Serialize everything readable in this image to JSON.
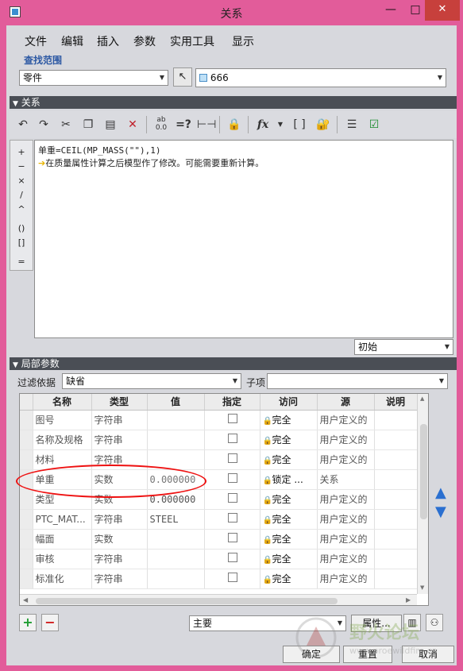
{
  "window": {
    "title": "关系",
    "minimize": "—",
    "maximize": "□",
    "close": "✕"
  },
  "menu": [
    "文件",
    "编辑",
    "插入",
    "参数",
    "实用工具",
    "显示"
  ],
  "scope": {
    "title": "查找范围",
    "type_value": "零件",
    "model_value": "666"
  },
  "relations": {
    "section_title": "关系",
    "operators": [
      "+",
      "−",
      "×",
      "/",
      "^",
      "()",
      "[]",
      "="
    ],
    "lines": [
      "单重=CEIL(MP_MASS(\"\"),1)",
      "在质量属性计算之后模型作了修改。可能需要重新计算。"
    ],
    "state_value": "初始"
  },
  "local_params": {
    "section_title": "局部参数",
    "filter_label": "过滤依据",
    "filter_value": "缺省",
    "subitem_label": "子项",
    "subitem_value": "",
    "columns": [
      "名称",
      "类型",
      "值",
      "指定",
      "访问",
      "源",
      "说明"
    ],
    "rows": [
      {
        "name": "图号",
        "type": "字符串",
        "value": "",
        "access": "完全",
        "source": "用户定义的"
      },
      {
        "name": "名称及规格",
        "type": "字符串",
        "value": "",
        "access": "完全",
        "source": "用户定义的"
      },
      {
        "name": "材料",
        "type": "字符串",
        "value": "",
        "access": "完全",
        "source": "用户定义的"
      },
      {
        "name": "单重",
        "type": "实数",
        "value": "0.000000",
        "access": "锁定 ...",
        "source": "关系"
      },
      {
        "name": "类型",
        "type": "实数",
        "value": "0.000000",
        "access": "完全",
        "source": "用户定义的"
      },
      {
        "name": "PTC_MAT...",
        "type": "字符串",
        "value": "STEEL",
        "access": "完全",
        "source": "用户定义的"
      },
      {
        "name": "幅面",
        "type": "实数",
        "value": "",
        "access": "完全",
        "source": "用户定义的"
      },
      {
        "name": "审核",
        "type": "字符串",
        "value": "",
        "access": "完全",
        "source": "用户定义的"
      },
      {
        "name": "标准化",
        "type": "字符串",
        "value": "",
        "access": "完全",
        "source": "用户定义的"
      }
    ]
  },
  "bottom": {
    "add": "+",
    "remove": "−",
    "main_value": "主要",
    "properties_label": "属性...",
    "ok_label": "确定",
    "reset_label": "重置",
    "cancel_label": "取消"
  },
  "watermark": {
    "text": "野火论坛",
    "url": "www.proewildfire.cn"
  },
  "colors": {
    "titlebar": "#e25c9a",
    "close": "#c7403c",
    "section_bar": "#4a4e55",
    "group_title": "#2c58a3",
    "highlight": "#e11111"
  }
}
